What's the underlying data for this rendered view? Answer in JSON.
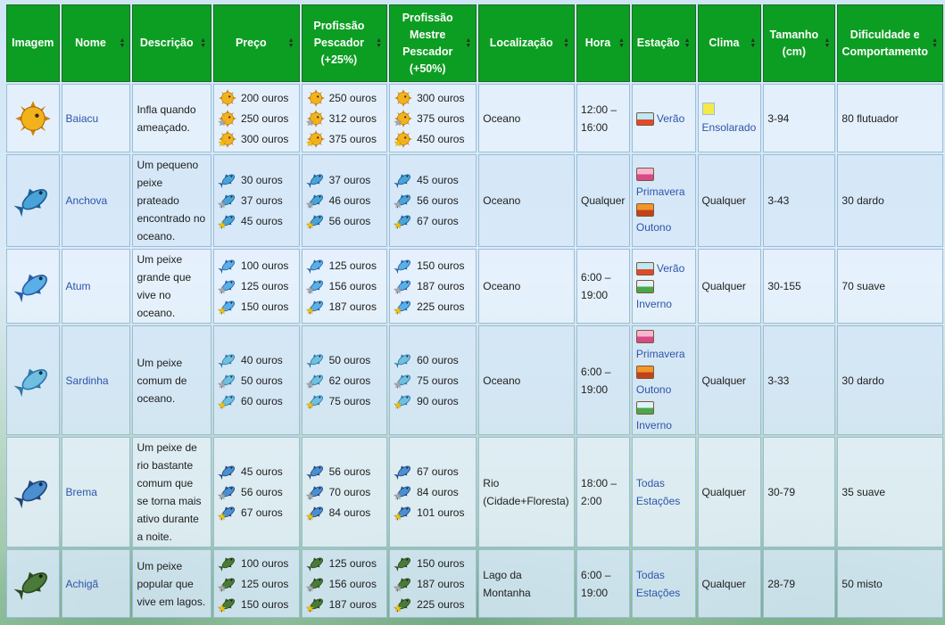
{
  "headers": {
    "image": "Imagem",
    "name": "Nome",
    "description": "Descrição",
    "price": "Preço",
    "fisher_line1": "Profissão",
    "fisher_line2": "Pescador",
    "fisher_line3": "(+25%)",
    "angler_line1": "Profissão",
    "angler_line2": "Mestre",
    "angler_line3": "Pescador",
    "angler_line4": "(+50%)",
    "location": "Localização",
    "time": "Hora",
    "season": "Estação",
    "weather": "Clima",
    "size_line1": "Tamanho",
    "size_line2": "(cm)",
    "difficulty_line1": "Dificuldade e",
    "difficulty_line2": "Comportamento"
  },
  "colors": {
    "header_bg": "#0c9e22",
    "link": "#2d55a8"
  },
  "fish": [
    {
      "icon": "pufferfish-icon",
      "name": "Baiacu",
      "description": [
        "Infla quando",
        "ameaçado."
      ],
      "price": [
        "200 ouros",
        "250 ouros",
        "300 ouros"
      ],
      "fisher": [
        "250 ouros",
        "312 ouros",
        "375 ouros"
      ],
      "angler": [
        "300 ouros",
        "375 ouros",
        "450 ouros"
      ],
      "location": [
        "Oceano"
      ],
      "time": [
        "12:00 –",
        "16:00"
      ],
      "seasons": [
        {
          "kind": "summer",
          "label": "Verão"
        }
      ],
      "weather": "Ensolarado",
      "size": "3-94",
      "difficulty": "80 flutuador"
    },
    {
      "icon": "anchovy-icon",
      "name": "Anchova",
      "description": [
        "Um pequeno",
        "peixe",
        "prateado",
        "encontrado no",
        "oceano."
      ],
      "price": [
        "30 ouros",
        "37 ouros",
        "45 ouros"
      ],
      "fisher": [
        "37 ouros",
        "46 ouros",
        "56 ouros"
      ],
      "angler": [
        "45 ouros",
        "56 ouros",
        "67 ouros"
      ],
      "location": [
        "Oceano"
      ],
      "time": [
        "Qualquer"
      ],
      "seasons": [
        {
          "kind": "spring",
          "label": "Primavera"
        },
        {
          "kind": "fall",
          "label": "Outono"
        }
      ],
      "weather": "Qualquer",
      "size": "3-43",
      "difficulty": "30 dardo"
    },
    {
      "icon": "tuna-icon",
      "name": "Atum",
      "description": [
        "Um peixe",
        "grande que",
        "vive no",
        "oceano."
      ],
      "price": [
        "100 ouros",
        "125 ouros",
        "150 ouros"
      ],
      "fisher": [
        "125 ouros",
        "156 ouros",
        "187 ouros"
      ],
      "angler": [
        "150 ouros",
        "187 ouros",
        "225 ouros"
      ],
      "location": [
        "Oceano"
      ],
      "time": [
        "6:00 –",
        "19:00"
      ],
      "seasons": [
        {
          "kind": "summer",
          "label": "Verão"
        },
        {
          "kind": "winter",
          "label": "Inverno"
        }
      ],
      "weather": "Qualquer",
      "size": "30-155",
      "difficulty": "70 suave"
    },
    {
      "icon": "sardine-icon",
      "name": "Sardinha",
      "description": [
        "Um peixe",
        "comum de",
        "oceano."
      ],
      "price": [
        "40 ouros",
        "50 ouros",
        "60 ouros"
      ],
      "fisher": [
        "50 ouros",
        "62 ouros",
        "75 ouros"
      ],
      "angler": [
        "60 ouros",
        "75 ouros",
        "90 ouros"
      ],
      "location": [
        "Oceano"
      ],
      "time": [
        "6:00 –",
        "19:00"
      ],
      "seasons": [
        {
          "kind": "spring",
          "label": "Primavera"
        },
        {
          "kind": "fall",
          "label": "Outono"
        },
        {
          "kind": "winter",
          "label": "Inverno"
        }
      ],
      "weather": "Qualquer",
      "size": "3-33",
      "difficulty": "30 dardo"
    },
    {
      "icon": "bream-icon",
      "name": "Brema",
      "description": [
        "Um peixe de",
        "rio bastante",
        "comum que",
        "se torna mais",
        "ativo durante",
        "a noite."
      ],
      "price": [
        "45 ouros",
        "56 ouros",
        "67 ouros"
      ],
      "fisher": [
        "56 ouros",
        "70 ouros",
        "84 ouros"
      ],
      "angler": [
        "67 ouros",
        "84 ouros",
        "101 ouros"
      ],
      "location": [
        "Rio",
        "(Cidade+Floresta)"
      ],
      "time": [
        "18:00 –",
        "2:00"
      ],
      "seasons": [
        {
          "kind": "all",
          "label": "Todas Estações"
        }
      ],
      "weather": "Qualquer",
      "size": "30-79",
      "difficulty": "35 suave"
    },
    {
      "icon": "largemouth-bass-icon",
      "name": "Achigã",
      "description": [
        "Um peixe",
        "popular que",
        "vive em lagos."
      ],
      "price": [
        "100 ouros",
        "125 ouros",
        "150 ouros"
      ],
      "fisher": [
        "125 ouros",
        "156 ouros",
        "187 ouros"
      ],
      "angler": [
        "150 ouros",
        "187 ouros",
        "225 ouros"
      ],
      "location": [
        "Lago da",
        "Montanha"
      ],
      "time": [
        "6:00 –",
        "19:00"
      ],
      "seasons": [
        {
          "kind": "all",
          "label": "Todas Estações"
        }
      ],
      "weather": "Qualquer",
      "size": "28-79",
      "difficulty": "50 misto"
    }
  ]
}
